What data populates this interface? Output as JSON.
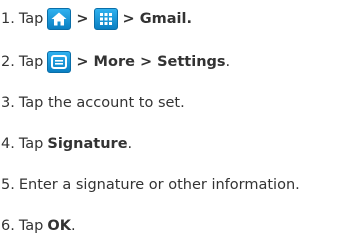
{
  "steps": [
    {
      "number": "1.",
      "prefix": "Tap",
      "icons": [
        "home-icon",
        "apps-grid-icon"
      ],
      "sep1": ">",
      "sep2": ">",
      "target": "Gmail."
    },
    {
      "number": "2.",
      "prefix": "Tap",
      "icons": [
        "menu-icon"
      ],
      "sep1": ">",
      "more": "More",
      "sep2": ">",
      "settings": "Settings",
      "suffix": "."
    },
    {
      "number": "3.",
      "text": "Tap the account to set."
    },
    {
      "number": "4.",
      "prefix": "Tap",
      "target": "Signature",
      "suffix": "."
    },
    {
      "number": "5.",
      "text": "Enter a signature or other information."
    },
    {
      "number": "6.",
      "prefix": "Tap",
      "target": "OK",
      "suffix": "."
    }
  ],
  "colors": {
    "text": "#333333",
    "icon_blue": "#1a98db"
  }
}
